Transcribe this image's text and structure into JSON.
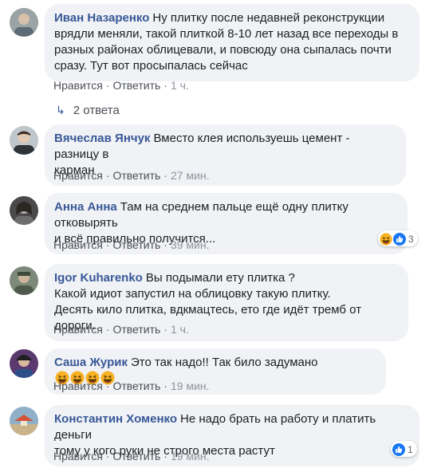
{
  "actions": {
    "like": "Нравится",
    "reply": "Ответить",
    "separator": "·"
  },
  "replies_link": {
    "label": "2 ответа"
  },
  "comments": [
    {
      "author": "Иван Назаренко",
      "text": "Ну плитку после недавней реконструкции\nврядли меняли, такой плиткой 8-10 лет назад все переходы в\nразных районах облицевали, и повсюду она сыпалась почти\nсразу. Тут вот просыпалась сейчас",
      "time": "1 ч."
    },
    {
      "author": "Вячеслав Янчук",
      "text": "Вместо клея используешь цемент - разницу в\nкарман",
      "time": "27 мин."
    },
    {
      "author": "Анна Анна",
      "text": "Там на среднем пальце ещё одну плитку отковырять\nи всё правильно получится...",
      "time": "39 мин.",
      "reaction_count": "3"
    },
    {
      "author": "Igor Kuharenko",
      "text": "Вы подымали ету плитка ?\nКакой идиот запустил на облицовку такую плитку.\nДесять кило плитка, вдкмацтесь, ето где идёт тремб от дороги.",
      "time": "1 ч."
    },
    {
      "author": "Саша Журик",
      "text": "Это так надо!! Так било задумано",
      "time": "19 мин."
    },
    {
      "author": "Константин Хоменко",
      "text": "Не надо брать на работу и платить деньги\nтому у кого руки не строго места растут",
      "time": "19 мин.",
      "reaction_count": "1"
    }
  ],
  "icons": {
    "laugh": "laughing-emoji-icon",
    "like": "like-thumb-icon"
  },
  "colors": {
    "author": "#385898",
    "bubble": "#f0f2f5",
    "meta": "#606770",
    "like_blue": "#1877f2",
    "emoji_yellow": "#f7b125"
  }
}
